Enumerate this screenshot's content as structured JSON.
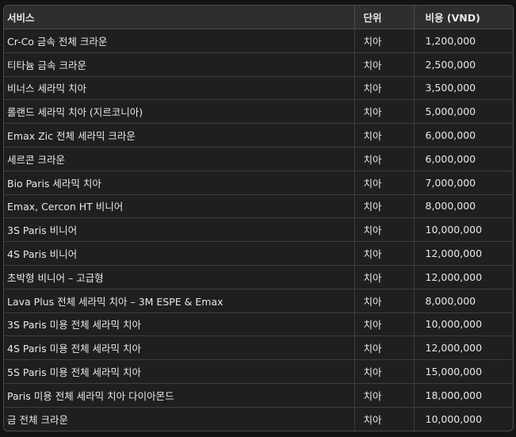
{
  "headers": {
    "service": "서비스",
    "unit": "단위",
    "cost": "비용 (VND)"
  },
  "rows": [
    {
      "service": "Cr-Co 금속 전체 크라운",
      "unit": "치아",
      "cost": "1,200,000"
    },
    {
      "service": "티타늄 금속 크라운",
      "unit": "치아",
      "cost": "2,500,000"
    },
    {
      "service": "비너스 세라믹 치아",
      "unit": "치아",
      "cost": "3,500,000"
    },
    {
      "service": "롤랜드 세라믹 치아 (지르코니아)",
      "unit": "치아",
      "cost": "5,000,000"
    },
    {
      "service": "Emax Zic 전체 세라믹 크라운",
      "unit": "치아",
      "cost": "6,000,000"
    },
    {
      "service": "세르콘 크라운",
      "unit": "치아",
      "cost": "6,000,000"
    },
    {
      "service": "Bio Paris 세라믹 치아",
      "unit": "치아",
      "cost": "7,000,000"
    },
    {
      "service": "Emax, Cercon HT 비니어",
      "unit": "치아",
      "cost": "8,000,000"
    },
    {
      "service": "3S Paris 비니어",
      "unit": "치아",
      "cost": "10,000,000"
    },
    {
      "service": "4S Paris 비니어",
      "unit": "치아",
      "cost": "12,000,000"
    },
    {
      "service": "초박형 비니어 – 고급형",
      "unit": "치아",
      "cost": "12,000,000"
    },
    {
      "service": "Lava Plus 전체 세라믹 치아 – 3M ESPE & Emax",
      "unit": "치아",
      "cost": "8,000,000"
    },
    {
      "service": "3S Paris 미용 전체 세라믹 치아",
      "unit": "치아",
      "cost": "10,000,000"
    },
    {
      "service": "4S Paris 미용 전체 세라믹 치아",
      "unit": "치아",
      "cost": "12,000,000"
    },
    {
      "service": "5S Paris 미용 전체 세라믹 치아",
      "unit": "치아",
      "cost": "15,000,000"
    },
    {
      "service": "Paris 미용 전체 세라믹 치아 다이아몬드",
      "unit": "치아",
      "cost": "18,000,000"
    },
    {
      "service": "금 전체 크라운",
      "unit": "치아",
      "cost": "10,000,000"
    }
  ]
}
